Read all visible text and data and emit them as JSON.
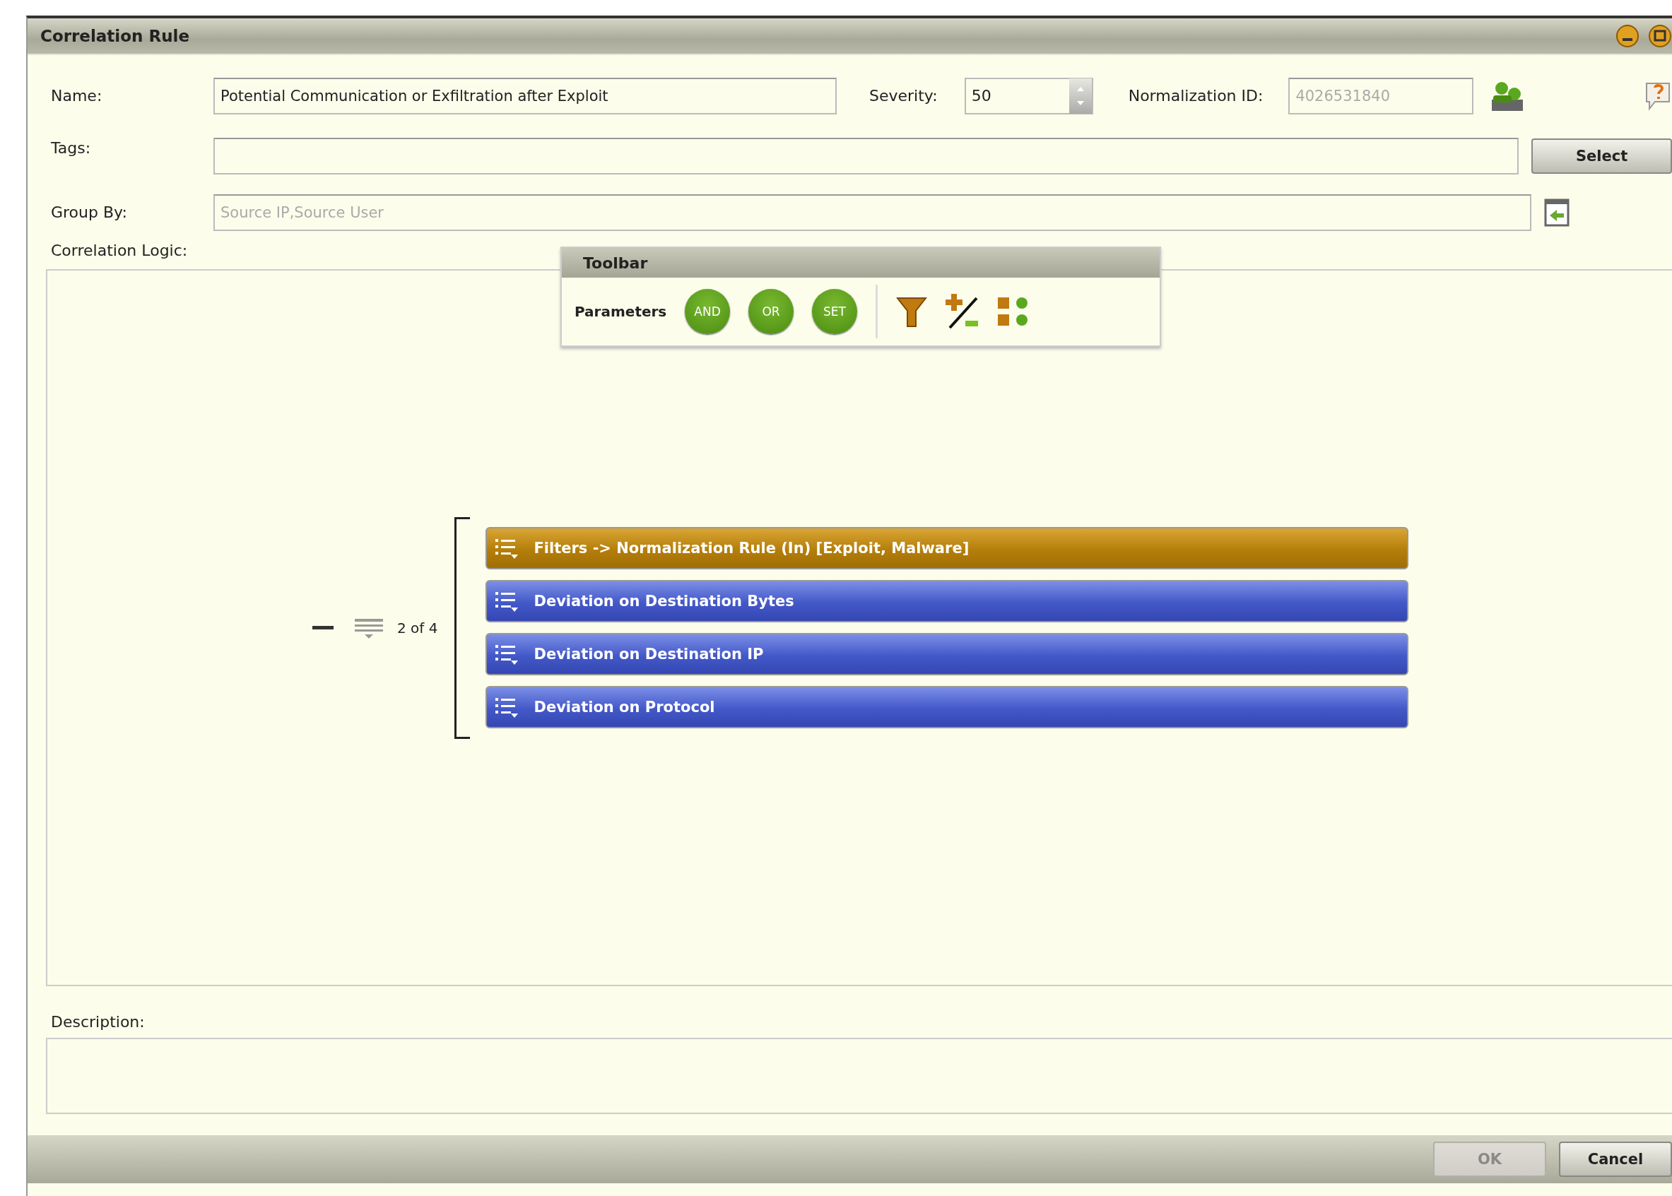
{
  "window": {
    "title": "Correlation Rule"
  },
  "fields": {
    "name": {
      "label": "Name:",
      "value": "Potential Communication or Exfiltration after Exploit"
    },
    "severity": {
      "label": "Severity:",
      "value": "50"
    },
    "normalization_id": {
      "label": "Normalization ID:",
      "value": "4026531840",
      "disabled": true
    },
    "tags": {
      "label": "Tags:",
      "button": "Select"
    },
    "group_by": {
      "label": "Group By:",
      "placeholder": "Source IP,Source User"
    }
  },
  "correlation_logic": {
    "label": "Correlation Logic:",
    "toolbar": {
      "title": "Toolbar",
      "label": "Parameters",
      "operators": [
        "AND",
        "OR",
        "SET"
      ]
    },
    "group": {
      "count": "2 of 4",
      "rules": [
        {
          "kind": "filter",
          "label": "Filters -> Normalization Rule (In) [Exploit, Malware]"
        },
        {
          "kind": "deviation",
          "label": "Deviation on Destination Bytes"
        },
        {
          "kind": "deviation",
          "label": "Deviation on Destination IP"
        },
        {
          "kind": "deviation",
          "label": "Deviation on Protocol"
        }
      ]
    }
  },
  "description": {
    "label": "Description:"
  },
  "buttons": [
    {
      "label": "OK",
      "disabled": true
    },
    {
      "label": "Cancel",
      "disabled": false
    }
  ]
}
